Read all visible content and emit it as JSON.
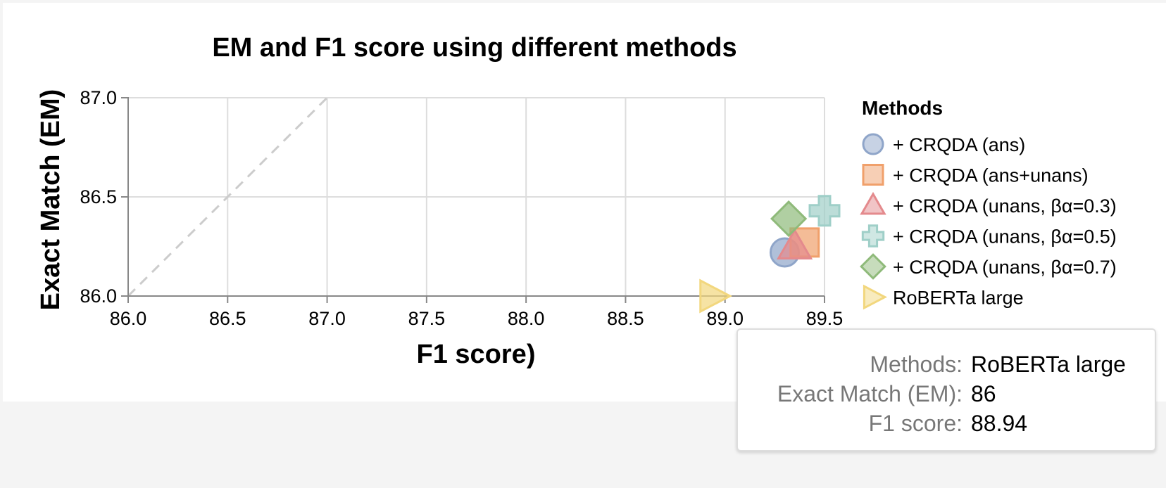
{
  "chart_data": {
    "type": "scatter",
    "title": "EM and F1 score using different methods",
    "xlabel": "F1 score)",
    "ylabel": "Exact Match (EM)",
    "xlim": [
      86.0,
      89.5
    ],
    "ylim": [
      86.0,
      87.0
    ],
    "x_ticks": [
      "86.0",
      "86.5",
      "87.0",
      "87.5",
      "88.0",
      "88.5",
      "89.0",
      "89.5"
    ],
    "y_ticks": [
      "86.0",
      "86.5",
      "87.0"
    ],
    "grid": true,
    "reference_line": {
      "style": "dashed",
      "from": [
        86.0,
        86.0
      ],
      "to": [
        87.0,
        87.0
      ]
    },
    "legend": {
      "title": "Methods",
      "placement": "right"
    },
    "series": [
      {
        "name": "+ CRQDA (ans)",
        "shape": "circle",
        "color": "#8fa5c9",
        "x": 89.3,
        "y": 86.22
      },
      {
        "name": "+ CRQDA (ans+unans)",
        "shape": "square",
        "color": "#f0a06b",
        "x": 89.4,
        "y": 86.27
      },
      {
        "name": "+ CRQDA (unans, βα=0.3)",
        "shape": "triangle",
        "color": "#e48a8d",
        "x": 89.35,
        "y": 86.25
      },
      {
        "name": "+ CRQDA (unans, βα=0.5)",
        "shape": "cross",
        "color": "#9fcfc8",
        "x": 89.5,
        "y": 86.43
      },
      {
        "name": "+ CRQDA (unans, βα=0.7)",
        "shape": "diamond",
        "color": "#8fba7a",
        "x": 89.32,
        "y": 86.39
      },
      {
        "name": "RoBERTa large",
        "shape": "triangle-right",
        "color": "#f2d77e",
        "x": 88.94,
        "y": 86.0
      }
    ]
  },
  "tooltip": {
    "rows": [
      {
        "key": "Methods:",
        "value": "RoBERTa large"
      },
      {
        "key": "Exact Match (EM):",
        "value": "86"
      },
      {
        "key": "F1 score:",
        "value": "88.94"
      }
    ]
  }
}
